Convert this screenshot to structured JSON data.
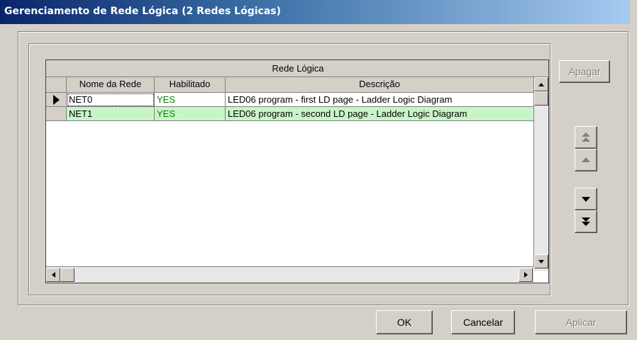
{
  "window": {
    "title": "Gerenciamento de Rede Lógica (2 Redes Lógicas)"
  },
  "grid": {
    "group_header": "Rede Lógica",
    "columns": [
      "Nome da Rede",
      "Habilitado",
      "Descrição"
    ],
    "rows": [
      {
        "name": "NET0",
        "enabled": "YES",
        "description": "LED06 program - first LD page - Ladder Logic Diagram"
      },
      {
        "name": "NET1",
        "enabled": "YES",
        "description": "LED06 program - second LD page - Ladder Logic Diagram"
      }
    ],
    "selected_row": 0
  },
  "buttons": {
    "delete": "Apagar",
    "ok": "OK",
    "cancel": "Cancelar",
    "apply": "Aplicar"
  },
  "nav_icons": [
    "move-to-top-icon",
    "move-up-icon",
    "move-down-icon",
    "move-to-bottom-icon"
  ],
  "colors": {
    "alt_row": "#c8f5c8",
    "enabled_text": "#008000",
    "title_bar": "#0a246a"
  }
}
